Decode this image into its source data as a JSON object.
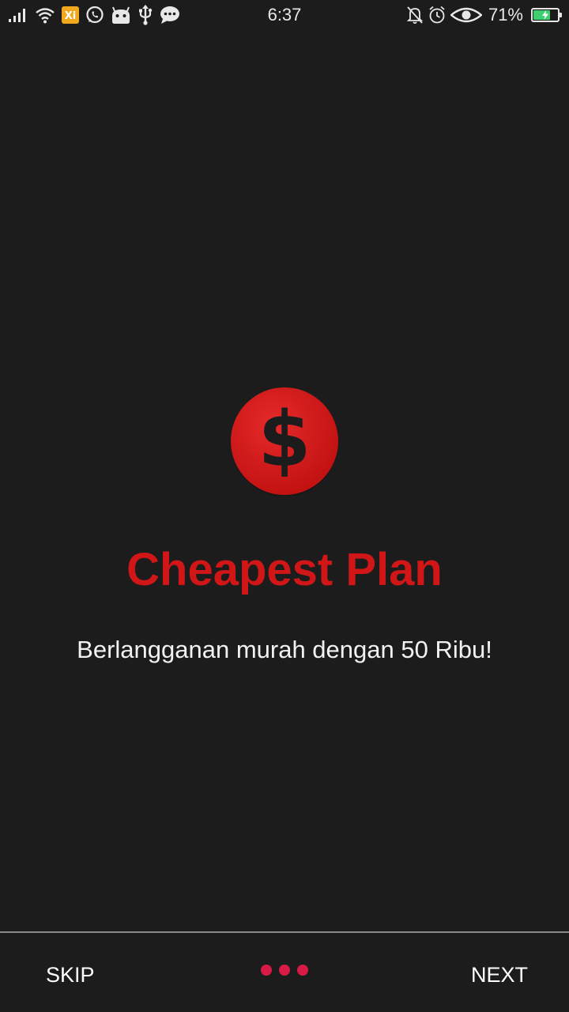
{
  "status_bar": {
    "time": "6:37",
    "battery_percent": "71%",
    "battery_level": 0.71,
    "left_icons": [
      "signal-icon",
      "wifi-icon",
      "xi-app-icon",
      "whatsapp-icon",
      "android-icon",
      "usb-icon",
      "chat-icon"
    ],
    "right_icons": [
      "bell-off-icon",
      "alarm-icon",
      "eye-icon"
    ]
  },
  "onboarding": {
    "icon": "dollar-coin-icon",
    "title": "Cheapest Plan",
    "description": "Berlangganan murah dengan 50 Ribu!",
    "page_count": 3
  },
  "navigation": {
    "skip_label": "SKIP",
    "next_label": "NEXT"
  },
  "colors": {
    "background": "#1c1c1c",
    "accent_red": "#d01616",
    "dot_color": "#d81b45",
    "battery_green": "#3cd070"
  }
}
